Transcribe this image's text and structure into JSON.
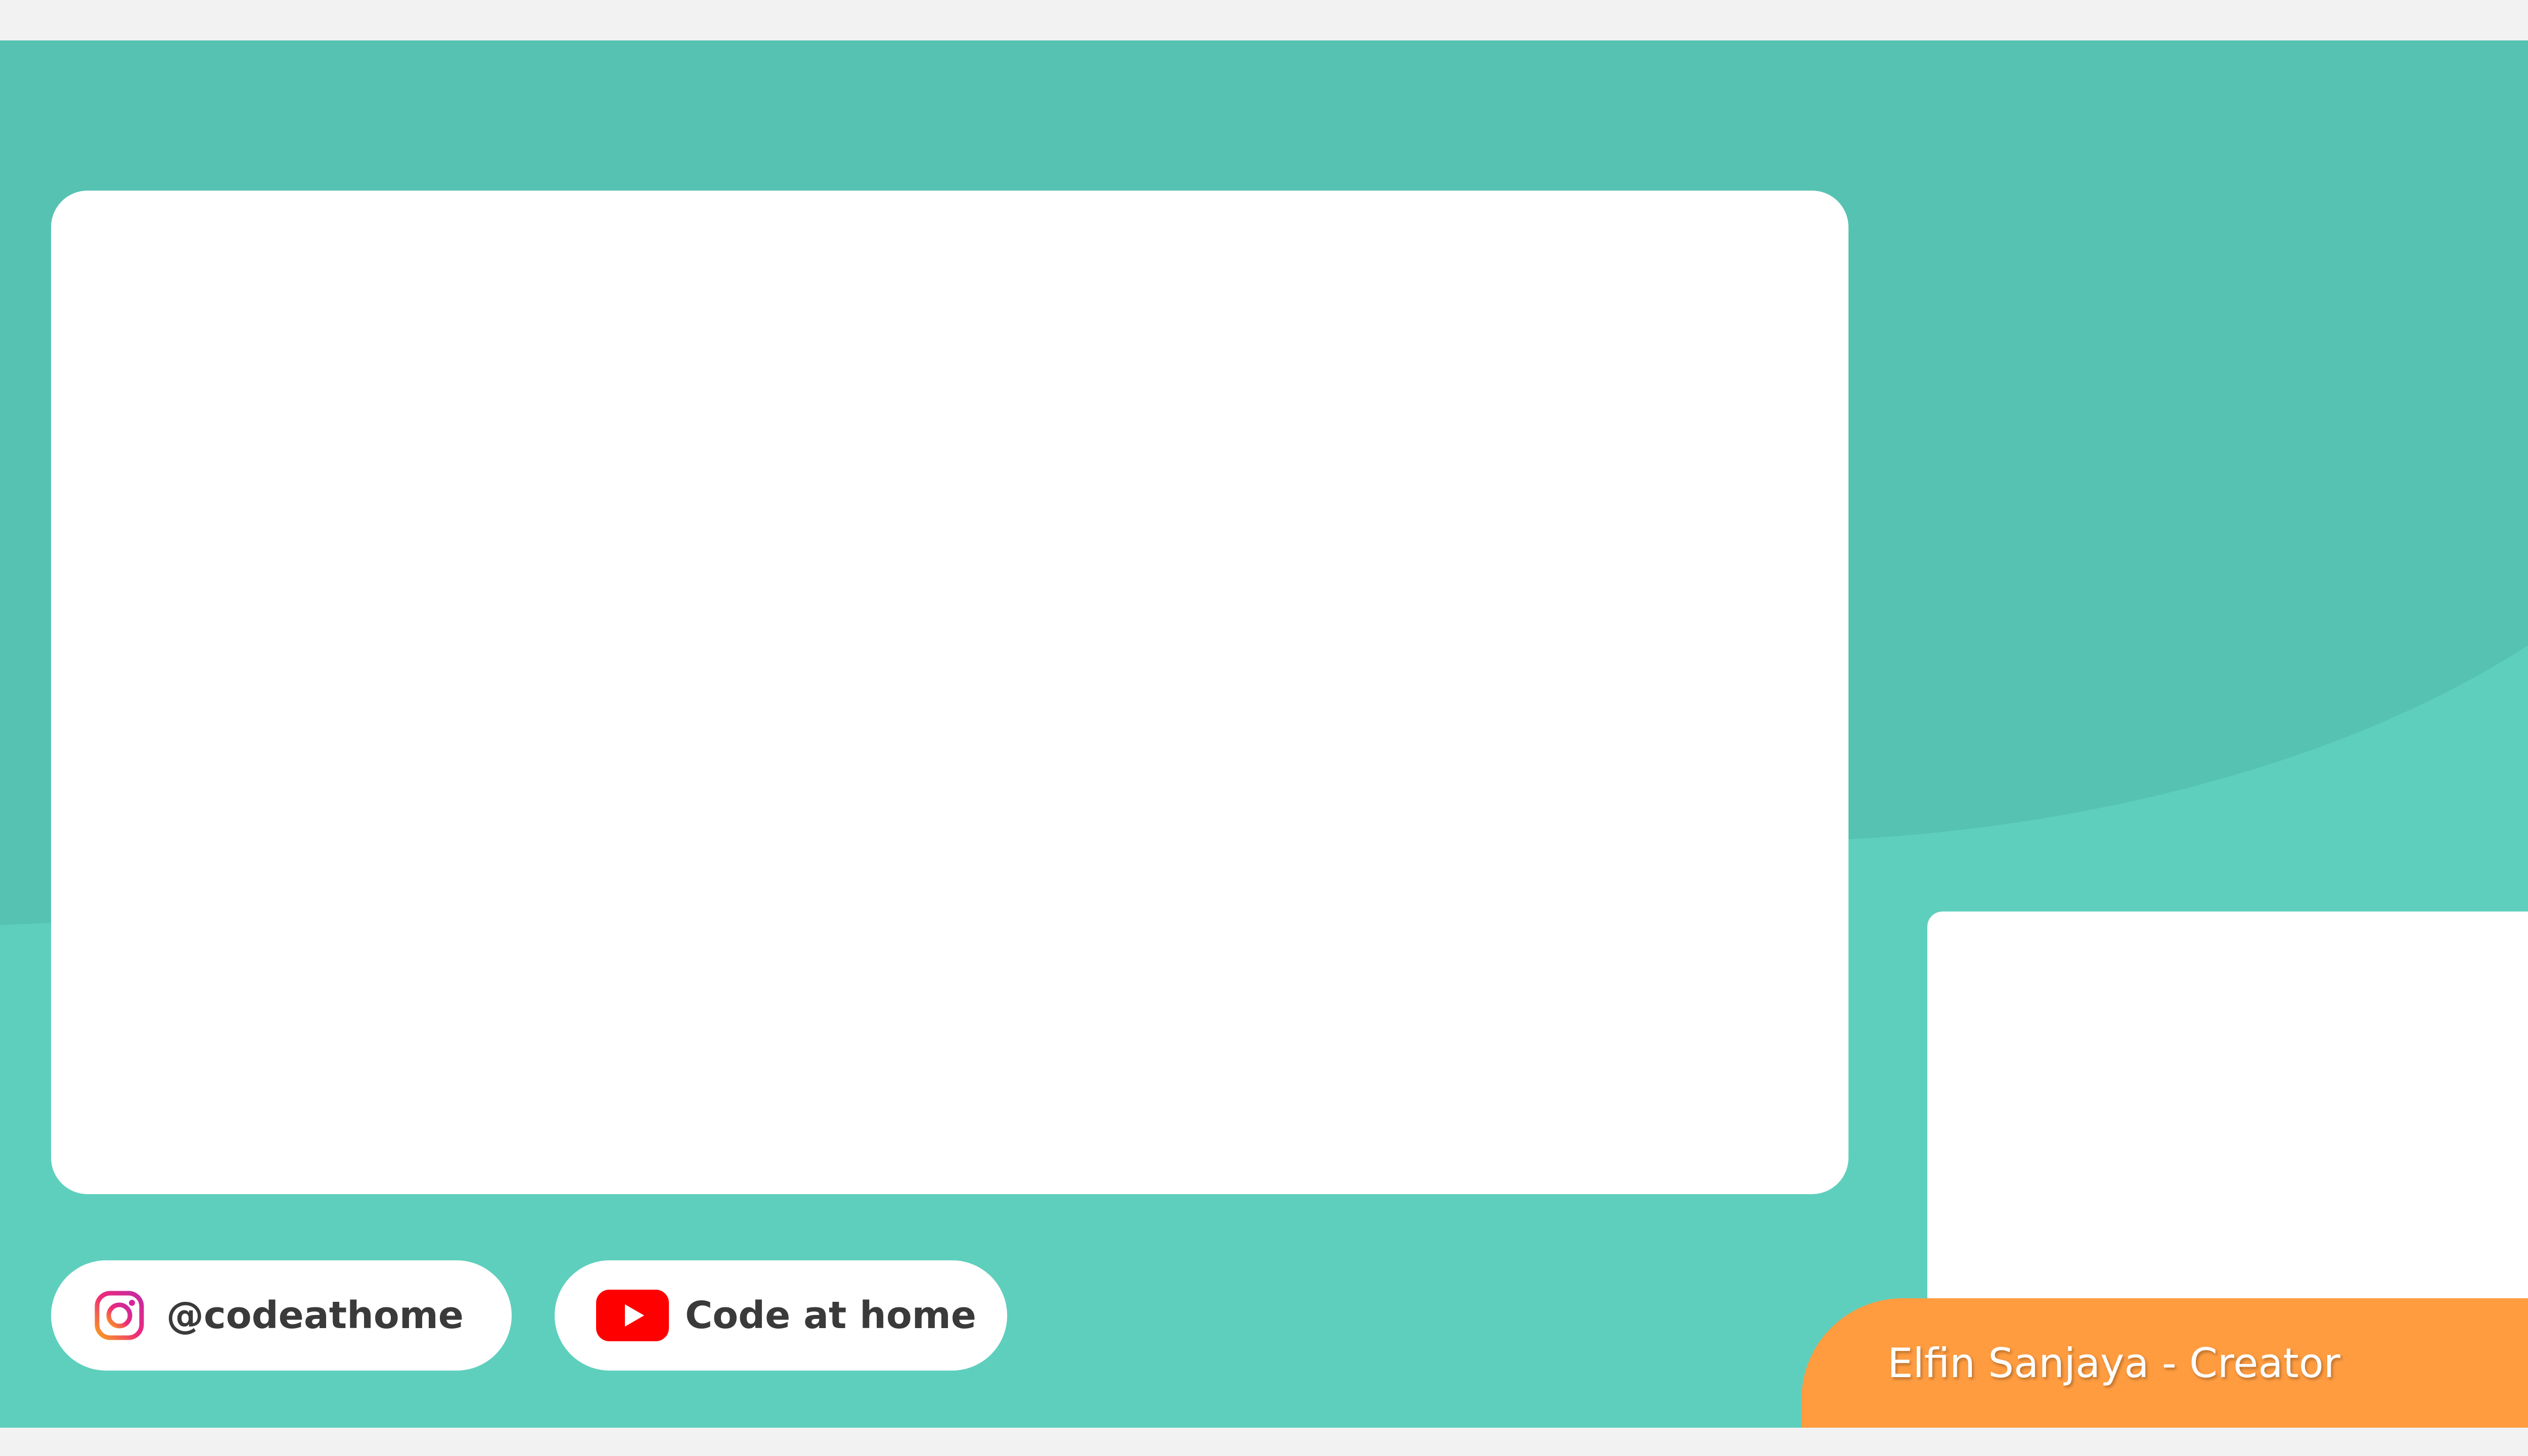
{
  "layout": {
    "main_screen": "",
    "camera_screen": ""
  },
  "social": {
    "instagram": {
      "icon": "instagram-icon",
      "handle": "@codeathome"
    },
    "youtube": {
      "icon": "youtube-icon",
      "channel": "Code at home"
    }
  },
  "name_tag": {
    "text": "Elfin Sanjaya - Creator"
  },
  "colors": {
    "background": "#5fcfbd",
    "background_wave": "#56c2b2",
    "page_margin": "#f2f2f2",
    "panel": "#ffffff",
    "name_tag": "#ff9c40",
    "instagram_gradient": [
      "#f9a11b",
      "#ee2a7b",
      "#c32aa3"
    ],
    "youtube_red": "#ff0000",
    "label_text": "#3a3a3a"
  }
}
